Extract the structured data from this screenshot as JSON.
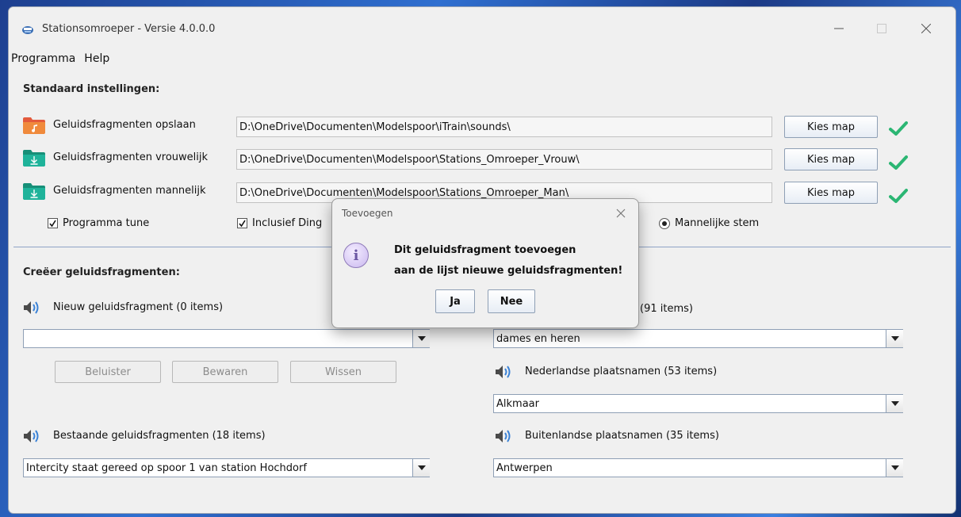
{
  "window": {
    "title": "Stationsomroeper - Versie 4.0.0.0"
  },
  "menu": [
    "Programma",
    "Help"
  ],
  "standard": {
    "title": "Standaard instellingen:",
    "rows": [
      {
        "label": "Geluidsfragmenten opslaan",
        "path": "D:\\OneDrive\\Documenten\\Modelspoor\\iTrain\\sounds\\",
        "button": "Kies map",
        "icon": "music-folder-icon"
      },
      {
        "label": "Geluidsfragmenten vrouwelijk",
        "path": "D:\\OneDrive\\Documenten\\Modelspoor\\Stations_Omroeper_Vrouw\\",
        "button": "Kies map",
        "icon": "download-folder-icon"
      },
      {
        "label": "Geluidsfragmenten mannelijk",
        "path": "D:\\OneDrive\\Documenten\\Modelspoor\\Stations_Omroeper_Man\\",
        "button": "Kies map",
        "icon": "download-folder-icon"
      }
    ],
    "options": {
      "tune": "Programma tune",
      "ding": "Inclusief Ding",
      "male_voice": "Mannelijke stem"
    }
  },
  "create": {
    "title": "Creëer geluidsfragmenten:",
    "new_label": "Nieuw geluidsfragment (0 items)",
    "new_value": "",
    "buttons": {
      "listen": "Beluister",
      "save": "Bewaren",
      "clear": "Wissen"
    },
    "existing_label": "Bestaande geluidsfragmenten (18 items)",
    "existing_value": "Intercity staat gereed op spoor 1 van station Hochdorf",
    "general_count": "(91 items)",
    "general_value": "dames en heren",
    "dutch_label": "Nederlandse plaatsnamen (53 items)",
    "dutch_value": "Alkmaar",
    "foreign_label": "Buitenlandse plaatsnamen (35 items)",
    "foreign_value": "Antwerpen"
  },
  "dialog": {
    "title": "Toevoegen",
    "line1": "Dit geluidsfragment toevoegen",
    "line2": "aan de lijst nieuwe geluidsfragmenten!",
    "yes": "Ja",
    "no": "Nee"
  },
  "colors": {
    "check": "#2bb673",
    "folder_music": "#e35a3c",
    "folder_download": "#1fa38a",
    "speaker": "#3b82d6"
  }
}
